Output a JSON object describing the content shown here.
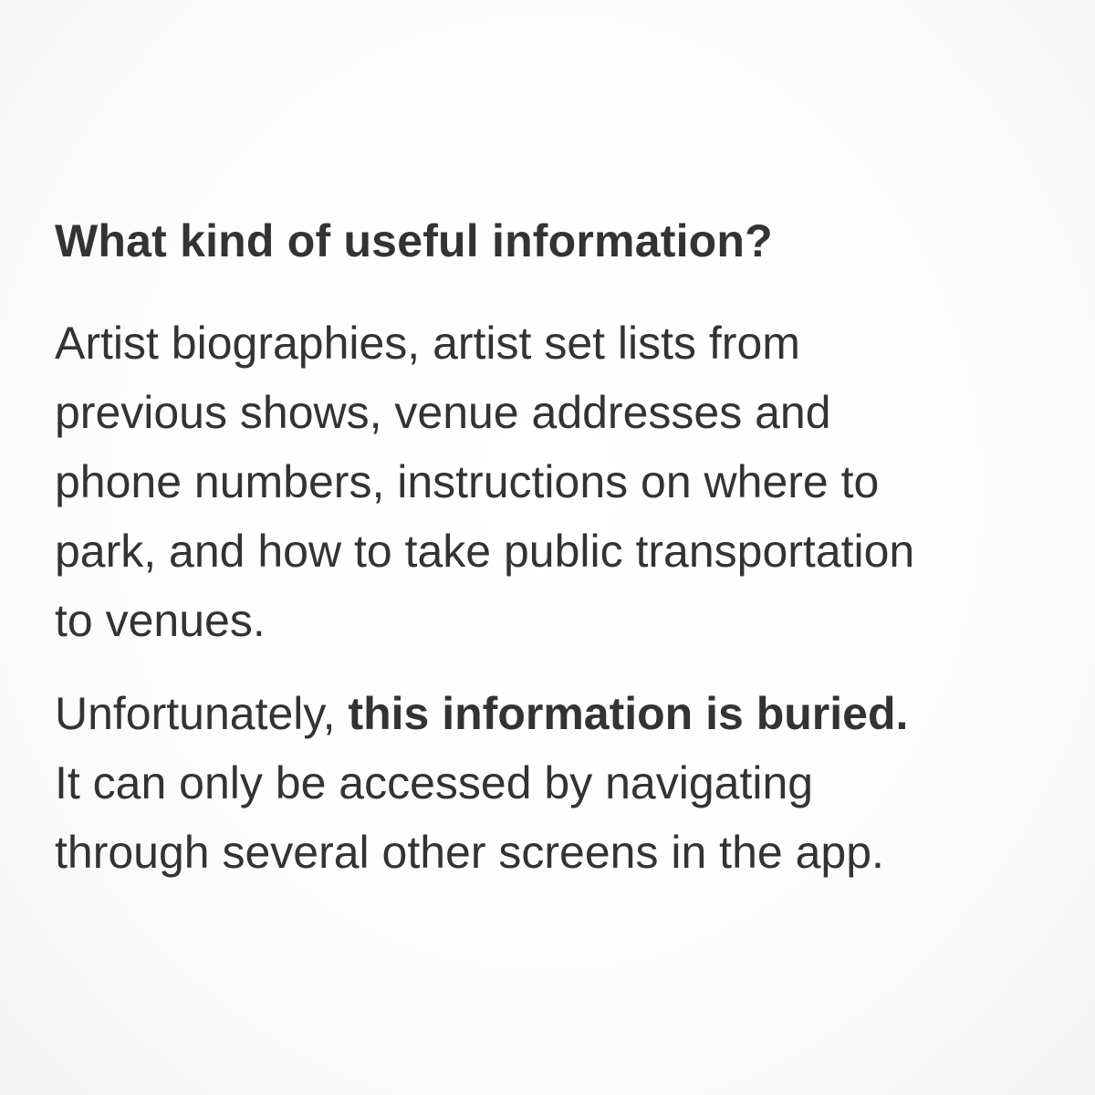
{
  "heading": "What kind of useful information?",
  "paragraph_1": {
    "lines": [
      "Artist biographies, artist set lists from",
      "previous shows, venue addresses and",
      "phone numbers, instructions on where to",
      "park, and how to take public transportation",
      "to venues."
    ]
  },
  "paragraph_2": {
    "intro": "Unfortunately, ",
    "emphasis": "this information is buried.",
    "lines": [
      "It can only be accessed by navigating",
      "through several other screens in the app."
    ]
  }
}
